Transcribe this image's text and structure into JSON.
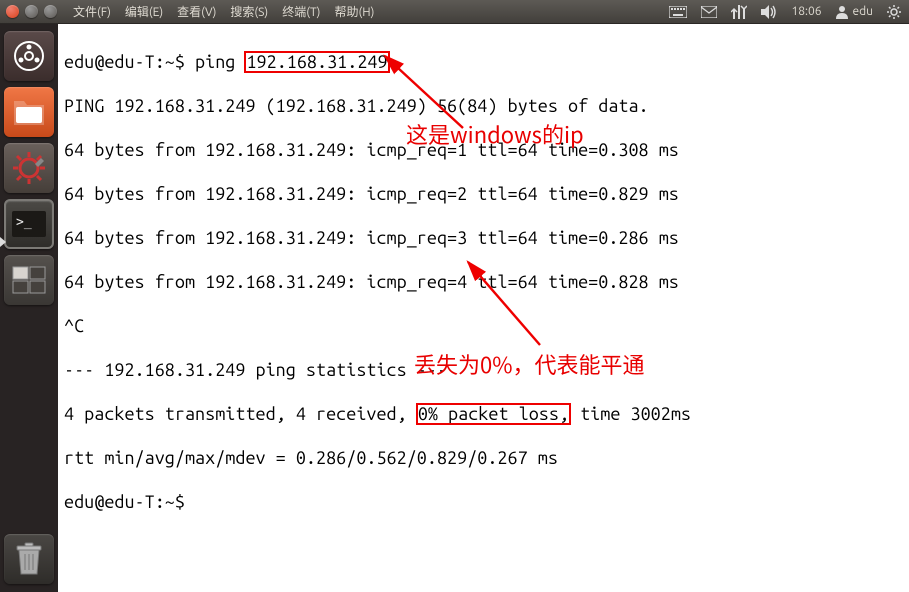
{
  "menubar": {
    "file": "文件(F)",
    "edit": "编辑(E)",
    "view": "查看(V)",
    "search": "搜索(S)",
    "terminal": "终端(T)",
    "help": "帮助(H)"
  },
  "panel": {
    "time": "18:06",
    "user": "edu"
  },
  "terminal": {
    "prompt1_pre": "edu@edu-T:~$ ping ",
    "ip_boxed": "192.168.31.249",
    "l2": "PING 192.168.31.249 (192.168.31.249) 56(84) bytes of data.",
    "l3": "64 bytes from 192.168.31.249: icmp_req=1 ttl=64 time=0.308 ms",
    "l4": "64 bytes from 192.168.31.249: icmp_req=2 ttl=64 time=0.829 ms",
    "l5": "64 bytes from 192.168.31.249: icmp_req=3 ttl=64 time=0.286 ms",
    "l6": "64 bytes from 192.168.31.249: icmp_req=4 ttl=64 time=0.828 ms",
    "l7": "^C",
    "l8": "--- 192.168.31.249 ping statistics ---",
    "l9a": "4 packets transmitted, 4 received, ",
    "l9_box": "0% packet loss,",
    "l9b": " time 3002ms",
    "l10": "rtt min/avg/max/mdev = 0.286/0.562/0.829/0.267 ms",
    "l11": "edu@edu-T:~$ "
  },
  "annotations": {
    "a1": "这是windows的ip",
    "a2": "丢失为0%，代表能平通"
  }
}
